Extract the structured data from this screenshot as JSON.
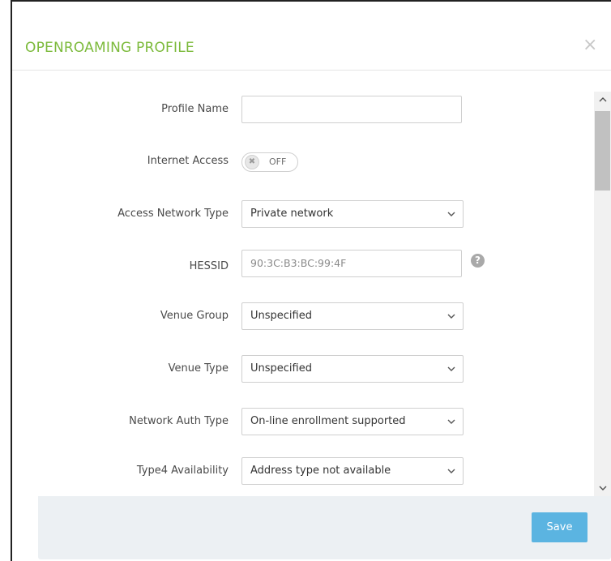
{
  "modal": {
    "title": "OPENROAMING PROFILE",
    "close_label": "×"
  },
  "form": {
    "profile_name": {
      "label": "Profile Name",
      "value": ""
    },
    "internet_access": {
      "label": "Internet Access",
      "state": "OFF",
      "knob_glyph": "✖"
    },
    "access_network_type": {
      "label": "Access Network Type",
      "value": "Private network"
    },
    "hessid": {
      "label": "HESSID",
      "placeholder": "90:3C:B3:BC:99:4F",
      "help_glyph": "?"
    },
    "venue_group": {
      "label": "Venue Group",
      "value": "Unspecified"
    },
    "venue_type": {
      "label": "Venue Type",
      "value": "Unspecified"
    },
    "network_auth_type": {
      "label": "Network Auth Type",
      "value": "On-line enrollment supported"
    },
    "type4_availability": {
      "label": "Type4 Availability",
      "value": "Address type not available"
    }
  },
  "footer": {
    "save_label": "Save"
  },
  "colors": {
    "title_green": "#7cba3b",
    "save_blue": "#5bb4e1",
    "footer_bg": "#ecf0f3"
  },
  "icons": [
    "close-icon",
    "chevron-down-icon",
    "help-icon",
    "scroll-up-icon",
    "scroll-down-icon"
  ]
}
